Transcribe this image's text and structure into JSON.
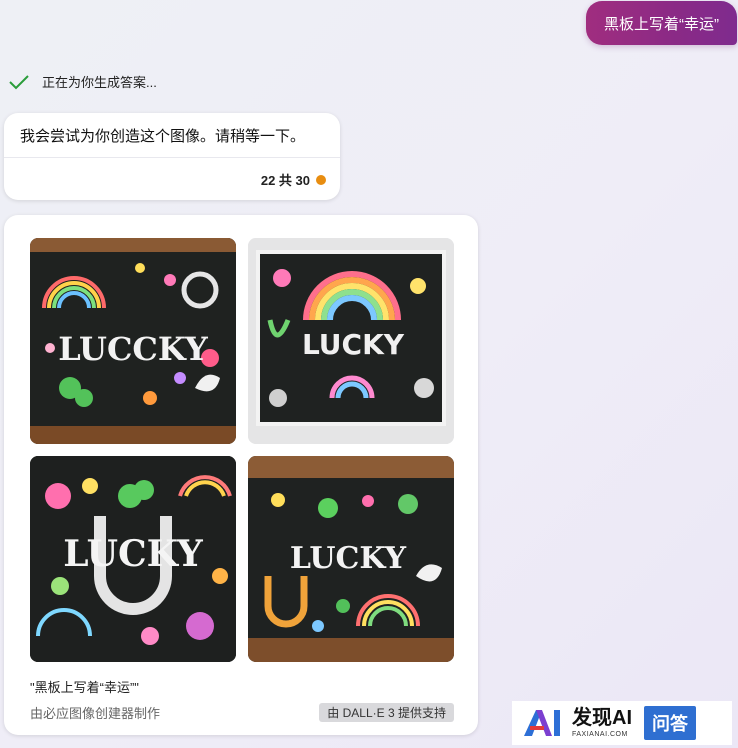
{
  "user_message": "黑板上写着“幸运”",
  "status": {
    "text": "正在为你生成答案..."
  },
  "assistant": {
    "message": "我会尝试为你创造这个图像。请稍等一下。",
    "counter": "22 共 30",
    "counter_dot_color": "#e88d10"
  },
  "result": {
    "images": [
      {
        "text": "LUCCKY"
      },
      {
        "text": "LUCKY"
      },
      {
        "text": "LUCKY"
      },
      {
        "text": "LUCKY"
      }
    ],
    "caption": "\"黑板上写着“幸运”\"",
    "creator": "由必应图像创建器制作",
    "badge": "由 DALL·E 3 提供支持"
  },
  "watermark": {
    "title": "发现AI",
    "subtitle": "FAXIANAI.COM",
    "box": "问答"
  }
}
